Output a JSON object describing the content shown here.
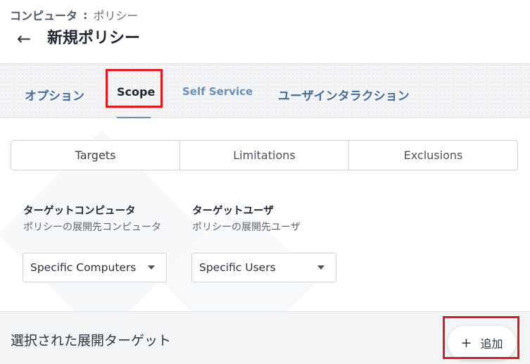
{
  "header": {
    "breadcrumb_parent": "コンピュータ",
    "breadcrumb_sep": ":",
    "breadcrumb_current": "ポリシー",
    "back_icon": "←",
    "title": "新規ポリシー"
  },
  "tabs": [
    {
      "label": "オプション"
    },
    {
      "label": "Scope",
      "active": true
    },
    {
      "label": "Self Service"
    },
    {
      "label": "ユーザインタラクション"
    }
  ],
  "segments": [
    {
      "label": "Targets",
      "active": true
    },
    {
      "label": "Limitations"
    },
    {
      "label": "Exclusions"
    }
  ],
  "fields": [
    {
      "title": "ターゲットコンピュータ",
      "description": "ポリシーの展開先コンピュータ",
      "value": "Specific Computers"
    },
    {
      "title": "ターゲットユーザ",
      "description": "ポリシーの展開先ユーザ",
      "value": "Specific Users"
    }
  ],
  "bottom": {
    "title": "選択された展開ターゲット",
    "add_icon": "+",
    "add_label": "追加"
  },
  "colors": {
    "highlight": "#e0191e",
    "tab_accent": "#6b8fb3",
    "tab_text": "#4a6c96"
  }
}
